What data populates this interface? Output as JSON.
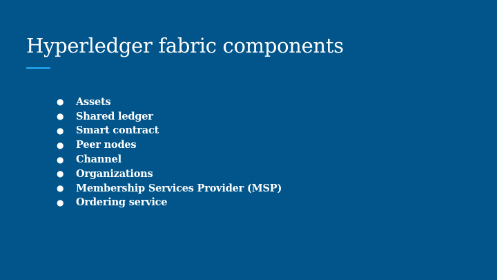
{
  "slide": {
    "title": "Hyperledger fabric components",
    "accent_color": "#1E9BE0",
    "background_color": "#01558A",
    "bullet_symbol": "●",
    "bullets": [
      "Assets",
      "Shared ledger",
      "Smart contract",
      "Peer nodes",
      "Channel",
      "Organizations",
      "Membership Services Provider (MSP)",
      "Ordering service"
    ]
  }
}
